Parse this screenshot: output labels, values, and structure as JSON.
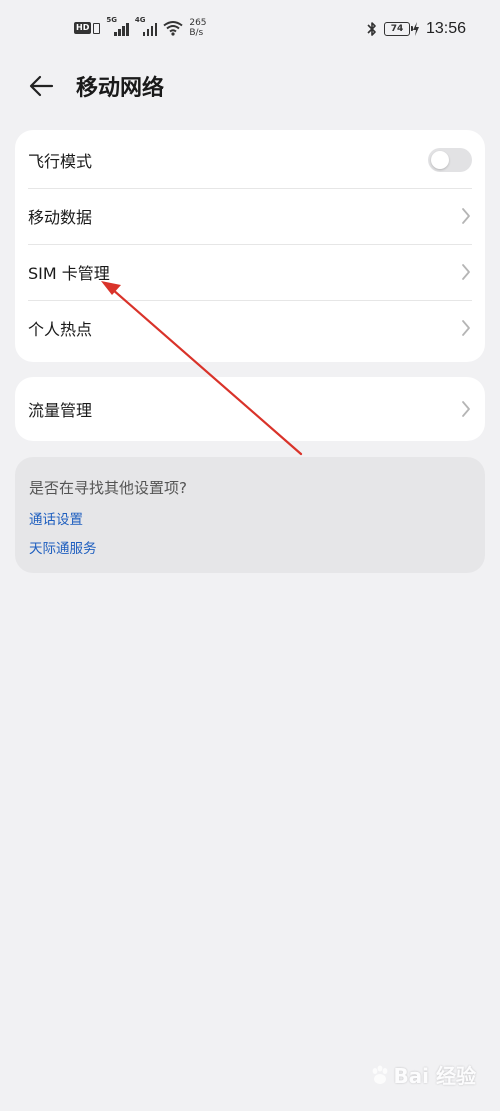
{
  "status_bar": {
    "hd_label": "HD",
    "signal1_gen": "5G",
    "signal2_gen": "4G",
    "net_speed_value": "265",
    "net_speed_unit": "B/s",
    "battery": "74",
    "time": "13:56"
  },
  "header": {
    "title": "移动网络",
    "back_icon": "back-arrow-icon"
  },
  "settings_card": {
    "items": [
      {
        "label": "飞行模式",
        "control": "toggle",
        "state": "off"
      },
      {
        "label": "移动数据",
        "control": "chevron"
      },
      {
        "label": "SIM 卡管理",
        "control": "chevron"
      },
      {
        "label": "个人热点",
        "control": "chevron"
      }
    ]
  },
  "traffic_card": {
    "items": [
      {
        "label": "流量管理",
        "control": "chevron"
      }
    ]
  },
  "suggestions": {
    "title": "是否在寻找其他设置项?",
    "links": [
      "通话设置",
      "天际通服务"
    ]
  },
  "colors": {
    "background": "#f1f1f3",
    "card": "#ffffff",
    "link": "#1f5fbf",
    "annotation_arrow": "#d9332a"
  },
  "watermark": {
    "text": "Bai  经验"
  }
}
